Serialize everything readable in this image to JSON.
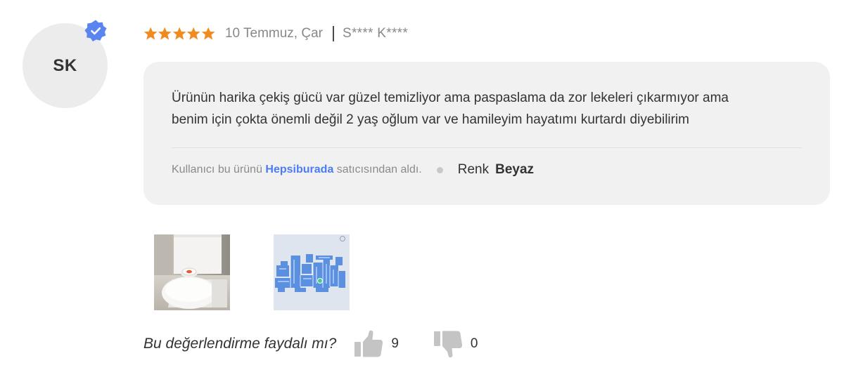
{
  "reviewer": {
    "initials": "SK",
    "name": "S**** K****",
    "verified": true
  },
  "review": {
    "rating": 5,
    "rating_max": 5,
    "date": "10 Temmuz, Çar",
    "comment_line1": "Ürünün harika çekiş gücü var güzel temizliyor ama paspaslama da zor lekeleri çıkarmıyor ama",
    "comment_line2": "benim için çokta önemli değil 2 yaş oğlum var ve hamileyim hayatımı kurtardı diyebilirim"
  },
  "purchase": {
    "prefix": "Kullanıcı bu ürünü ",
    "store": "Hepsiburada",
    "suffix": " satıcısından aldı.",
    "variant_label": "Renk",
    "variant_value": "Beyaz"
  },
  "helpful": {
    "question": "Bu değerlendirme faydalı mı?",
    "likes": "9",
    "dislikes": "0"
  },
  "colors": {
    "star": "#f28b1d",
    "badge": "#5a84f0",
    "link": "#4c7cf3",
    "bubble": "#f1f1f1",
    "thumb_icon": "#c4c4c4"
  },
  "icons": [
    "verified-badge-icon",
    "star-icon",
    "thumbs-up-icon",
    "thumbs-down-icon"
  ]
}
